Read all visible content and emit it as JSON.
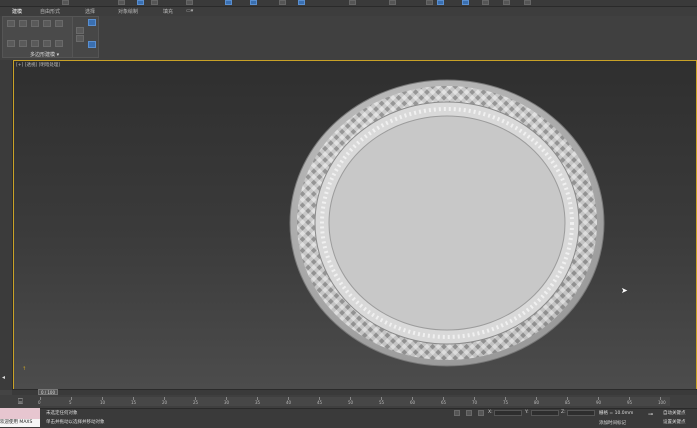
{
  "ribbon": {
    "tabs": [
      {
        "label": "建模"
      },
      {
        "label": "自由形式"
      },
      {
        "label": "选择"
      },
      {
        "label": "对象绘制"
      },
      {
        "label": "填充"
      }
    ],
    "group_label": "多边形建模 ▾"
  },
  "viewport": {
    "label": "[+] [透视] [明暗处理]"
  },
  "timeline": {
    "frame_counter": "0 / 100",
    "ticks": [
      "0",
      "5",
      "10",
      "15",
      "20",
      "25",
      "30",
      "35",
      "40",
      "45",
      "50",
      "55",
      "60",
      "65",
      "70",
      "75",
      "80",
      "85",
      "90",
      "95",
      "100"
    ]
  },
  "status": {
    "selection_text": "未选定任何对象",
    "prompt_text": "单击并拖动以选择并移动对象",
    "welcome_text": "欢迎使用 MAXS",
    "x_label": "X:",
    "y_label": "Y:",
    "z_label": "Z:",
    "grid_text": "栅格 = 10.0mm",
    "add_time_tag": "添加时间标记",
    "auto_key": "自动关键点",
    "set_key": "设置关键点"
  },
  "colors": {
    "viewport_border": "#c9a227",
    "accent_blue": "#3a6fb0"
  }
}
